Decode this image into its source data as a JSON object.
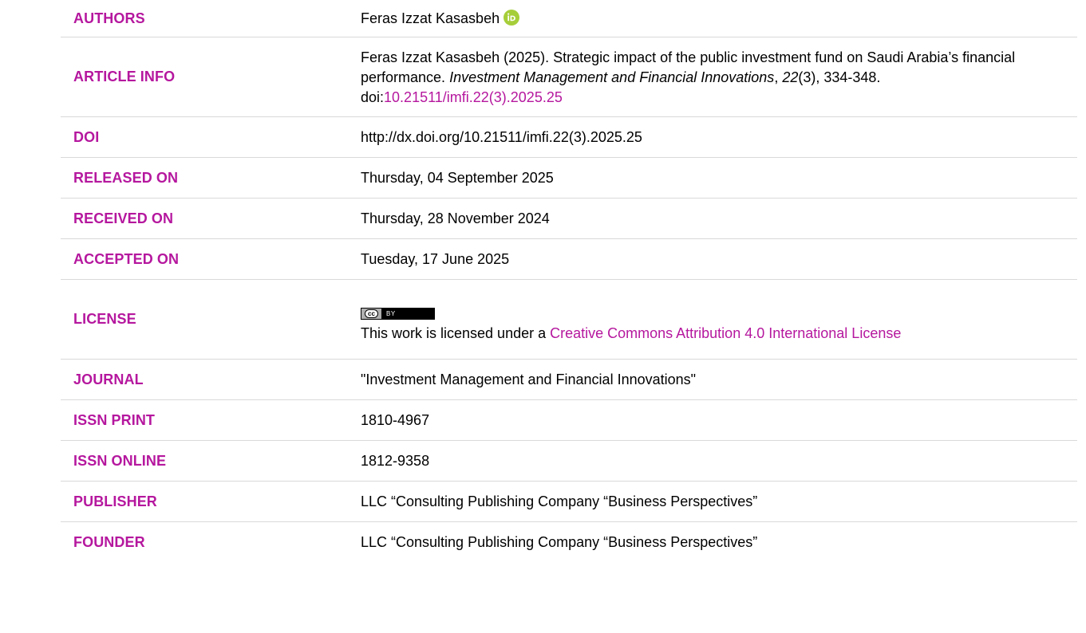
{
  "colors": {
    "accent": "#b5179e",
    "orcid": "#a6ce39"
  },
  "rows": {
    "authors": {
      "label": "AUTHORS",
      "name": "Feras Izzat Kasasbeh",
      "orcid_icon": "orcid-id-icon"
    },
    "article_info": {
      "label": "ARTICLE INFO",
      "prefix": "Feras Izzat Kasasbeh (2025). Strategic impact of the public investment fund on Saudi Arabia’s financial performance. ",
      "journal_italic": "Investment Management and Financial Innovations",
      "sep1": ", ",
      "volume_italic": "22",
      "issue_pages": "(3), 334-348. doi:",
      "doi_link": "10.21511/imfi.22(3).2025.25"
    },
    "doi": {
      "label": "DOI",
      "value": "http://dx.doi.org/10.21511/imfi.22(3).2025.25"
    },
    "released": {
      "label": "RELEASED ON",
      "value": "Thursday, 04 September 2025"
    },
    "received": {
      "label": "RECEIVED ON",
      "value": "Thursday, 28 November 2024"
    },
    "accepted": {
      "label": "ACCEPTED ON",
      "value": "Tuesday, 17 June 2025"
    },
    "license": {
      "label": "LICENSE",
      "badge_cc": "cc",
      "badge_by": "BY",
      "text": "This work is licensed under a ",
      "link": "Creative Commons Attribution 4.0 International License"
    },
    "journal": {
      "label": "JOURNAL",
      "value": "\"Investment Management and Financial Innovations\""
    },
    "issn_print": {
      "label": "ISSN PRINT",
      "value": "1810-4967"
    },
    "issn_online": {
      "label": "ISSN ONLINE",
      "value": "1812-9358"
    },
    "publisher": {
      "label": "PUBLISHER",
      "value": "LLC “Consulting Publishing Company “Business Perspectives”"
    },
    "founder": {
      "label": "FOUNDER",
      "value": "LLC “Consulting Publishing Company “Business Perspectives”"
    }
  }
}
